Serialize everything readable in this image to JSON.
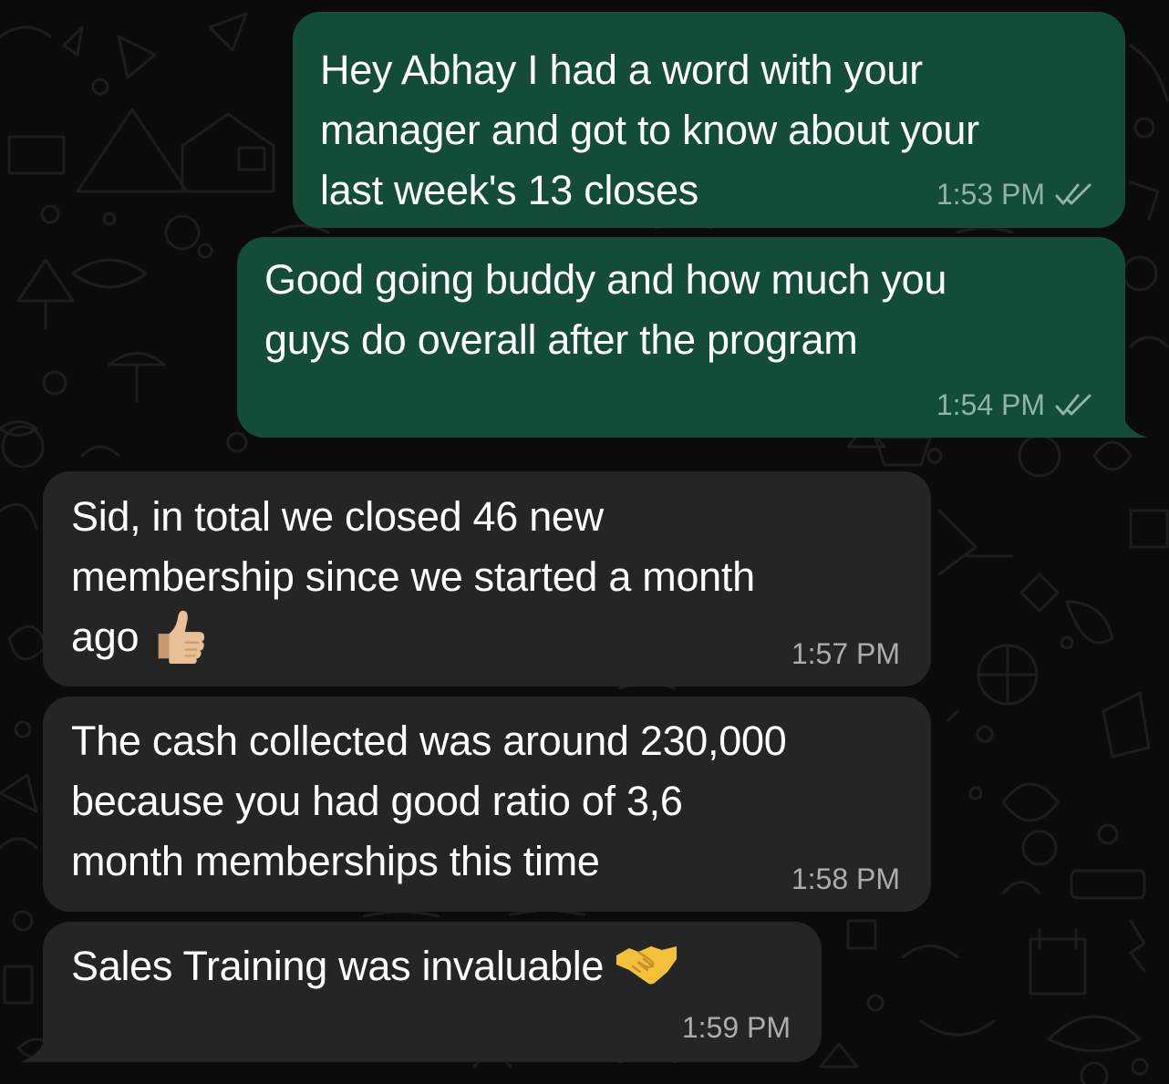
{
  "colors": {
    "outgoing_bubble": "#134d37",
    "incoming_bubble": "#242626",
    "background": "#0b0b0b",
    "text": "#ffffff",
    "read_ticks": "#8fb5a4"
  },
  "messages": [
    {
      "direction": "outgoing",
      "text": "Hey Abhay I had a word with your\nmanager and got to know about your\nlast week's 13 closes",
      "time": "1:53 PM",
      "status": "read",
      "status_icon": "double-check-icon"
    },
    {
      "direction": "outgoing",
      "text": "Good going buddy and how much you\nguys do overall after the program",
      "time": "1:54 PM",
      "status": "read",
      "status_icon": "double-check-icon"
    },
    {
      "direction": "incoming",
      "text": "Sid, in total we closed 46 new\nmembership since we started a month\nago",
      "emoji": "thumbs-up-icon",
      "time": "1:57 PM"
    },
    {
      "direction": "incoming",
      "text": "The cash collected was around 230,000\nbecause you had good ratio of 3,6\nmonth memberships this time",
      "time": "1:58 PM"
    },
    {
      "direction": "incoming",
      "text": "Sales Training was invaluable",
      "emoji": "handshake-icon",
      "time": "1:59 PM"
    }
  ]
}
